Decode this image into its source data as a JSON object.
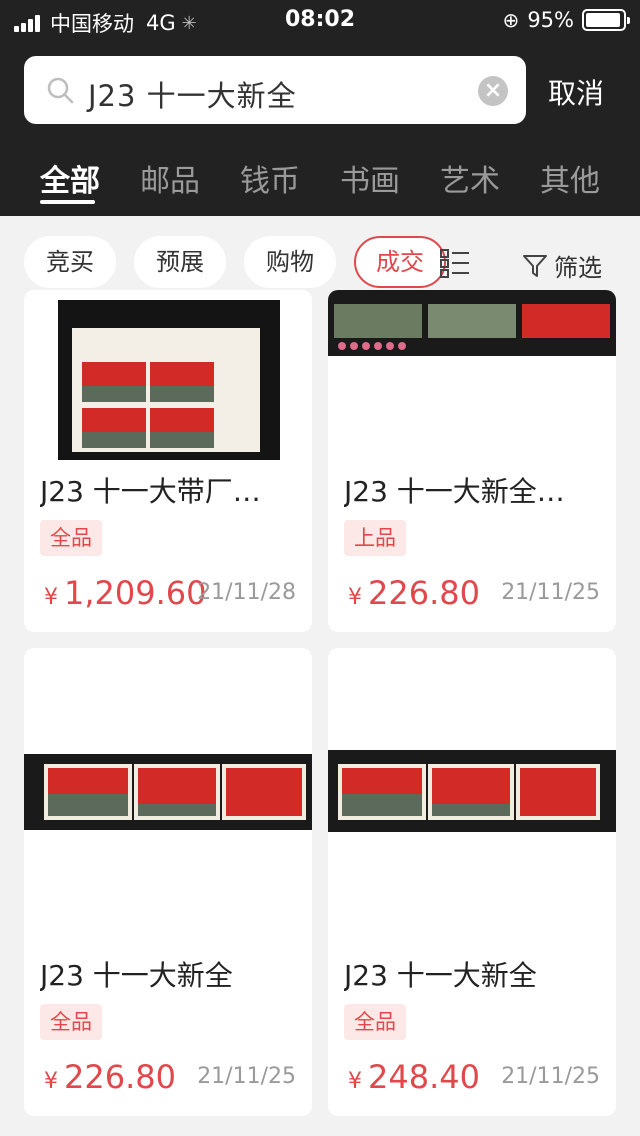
{
  "status_bar": {
    "carrier": "中国移动",
    "network": "4G",
    "time": "08:02",
    "battery": "95%",
    "battery_level": 0.95
  },
  "search": {
    "query": "J23 十一大新全",
    "cancel_label": "取消"
  },
  "category_tabs": [
    {
      "label": "全部",
      "active": true
    },
    {
      "label": "邮品",
      "active": false
    },
    {
      "label": "钱币",
      "active": false
    },
    {
      "label": "书画",
      "active": false
    },
    {
      "label": "艺术",
      "active": false
    },
    {
      "label": "其他",
      "active": false
    }
  ],
  "filter_chips": [
    {
      "label": "竞买",
      "active": false
    },
    {
      "label": "预展",
      "active": false
    },
    {
      "label": "购物",
      "active": false
    },
    {
      "label": "成交",
      "active": true
    }
  ],
  "filter_button": "筛选",
  "colors": {
    "header_bg": "#222222",
    "accent": "#e0484b",
    "grade_bg": "#fde8e8",
    "page_bg": "#f2f2f2"
  },
  "items": [
    {
      "title": "J23 十一大带厂…",
      "grade": "全品",
      "currency": "¥",
      "price": "1,209.60",
      "date": "21/11/28"
    },
    {
      "title": "J23 十一大新全…",
      "grade": "上品",
      "currency": "¥",
      "price": "226.80",
      "date": "21/11/25"
    },
    {
      "title": "J23 十一大新全",
      "grade": "全品",
      "currency": "¥",
      "price": "226.80",
      "date": "21/11/25"
    },
    {
      "title": "J23 十一大新全",
      "grade": "全品",
      "currency": "¥",
      "price": "248.40",
      "date": "21/11/25"
    }
  ]
}
